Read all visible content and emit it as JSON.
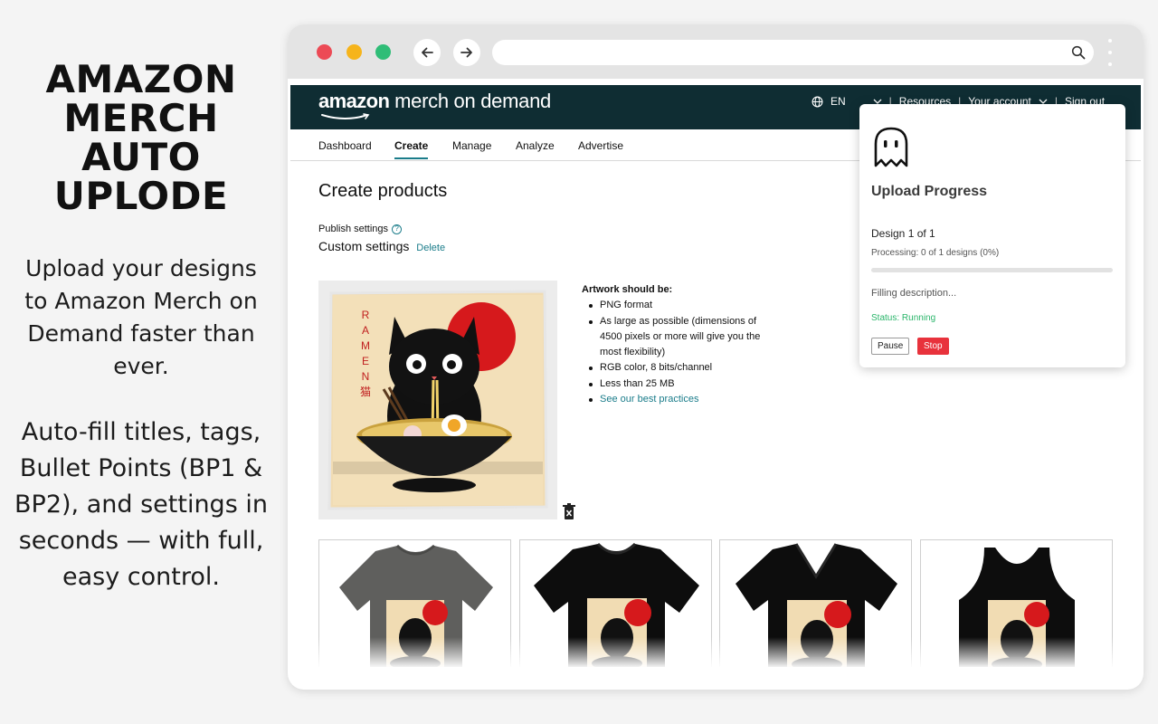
{
  "promo": {
    "title_lines": [
      "AMAZON",
      "MERCH",
      "AUTO",
      "UPLODE"
    ],
    "paragraph1": "Upload your designs to Amazon Merch on Demand faster than ever.",
    "paragraph2": "Auto-fill titles, tags, Bullet Points (BP1 & BP2), and settings in seconds — with full, easy control."
  },
  "site": {
    "logo_prefix": "amazon",
    "logo_suffix": " merch on demand",
    "language": "EN",
    "resources": "Resources",
    "account": "Your account",
    "signout": "Sign out",
    "tabs": [
      "Dashboard",
      "Create",
      "Manage",
      "Analyze",
      "Advertise"
    ],
    "active_tab": "Create",
    "page_title": "Create products",
    "publish_settings_label": "Publish settings",
    "custom_settings": "Custom settings",
    "delete_link": "Delete",
    "artwork_req_title": "Artwork should be:",
    "artwork_reqs": [
      "PNG format",
      "As large as possible (dimensions of 4500 pixels or more will give you the most flexibility)",
      "RGB color, 8 bits/channel",
      "Less than 25 MB"
    ],
    "best_practices_link": "See our best practices",
    "artwork_vertical_text": "RAMEN猫",
    "product_types": [
      "standard-tshirt-gray",
      "premium-tshirt-black",
      "vneck-tshirt-black",
      "tank-top-black"
    ]
  },
  "popup": {
    "title": "Upload Progress",
    "design_counter": "Design 1 of 1",
    "processing": "Processing: 0 of 1 designs (0%)",
    "progress": 0,
    "step": "Filling description...",
    "status": "Status: Running",
    "pause_label": "Pause",
    "stop_label": "Stop"
  },
  "colors": {
    "header_bg": "#0f2d33",
    "link": "#1a7c8a",
    "status_green": "#2ab56a",
    "stop_red": "#e8323c"
  }
}
